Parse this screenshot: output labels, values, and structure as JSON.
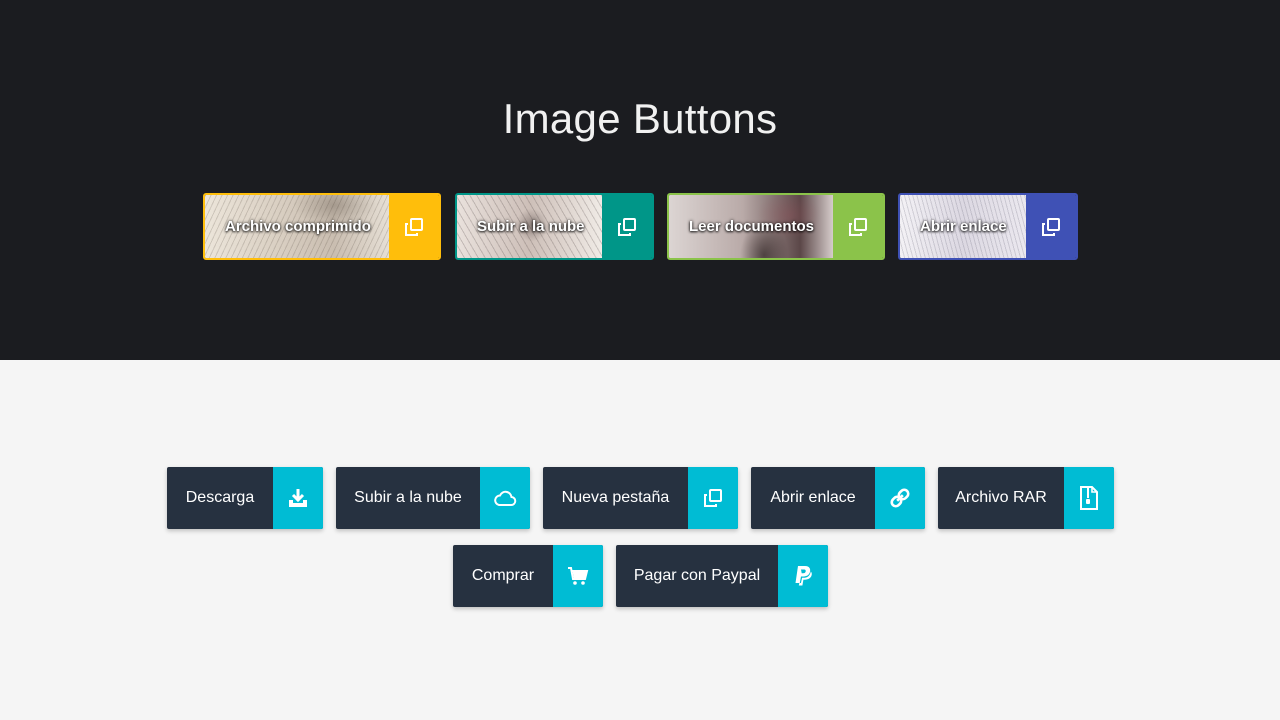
{
  "header": {
    "title": "Image Buttons"
  },
  "image_buttons": [
    {
      "label": "Archivo comprimido",
      "icon": "copy-icon",
      "accent": "#ffbe0b"
    },
    {
      "label": "Subir a la nube",
      "icon": "copy-icon",
      "accent": "#009688"
    },
    {
      "label": "Leer documentos",
      "icon": "copy-icon",
      "accent": "#8bc34a"
    },
    {
      "label": "Abrir enlace",
      "icon": "copy-icon",
      "accent": "#3f51b5"
    }
  ],
  "flat_buttons": [
    {
      "label": "Descarga",
      "icon": "download-icon"
    },
    {
      "label": "Subir a la nube",
      "icon": "cloud-icon"
    },
    {
      "label": "Nueva pestaña",
      "icon": "copy-icon"
    },
    {
      "label": "Abrir enlace",
      "icon": "link-icon"
    },
    {
      "label": "Archivo RAR",
      "icon": "zip-file-icon"
    },
    {
      "label": "Comprar",
      "icon": "cart-icon"
    },
    {
      "label": "Pagar con Paypal",
      "icon": "paypal-icon"
    }
  ],
  "colors": {
    "header_bg": "#1b1c20",
    "page_bg": "#f5f5f5",
    "flat_button_bg": "#263140",
    "flat_icon_bg": "#00bcd4"
  }
}
